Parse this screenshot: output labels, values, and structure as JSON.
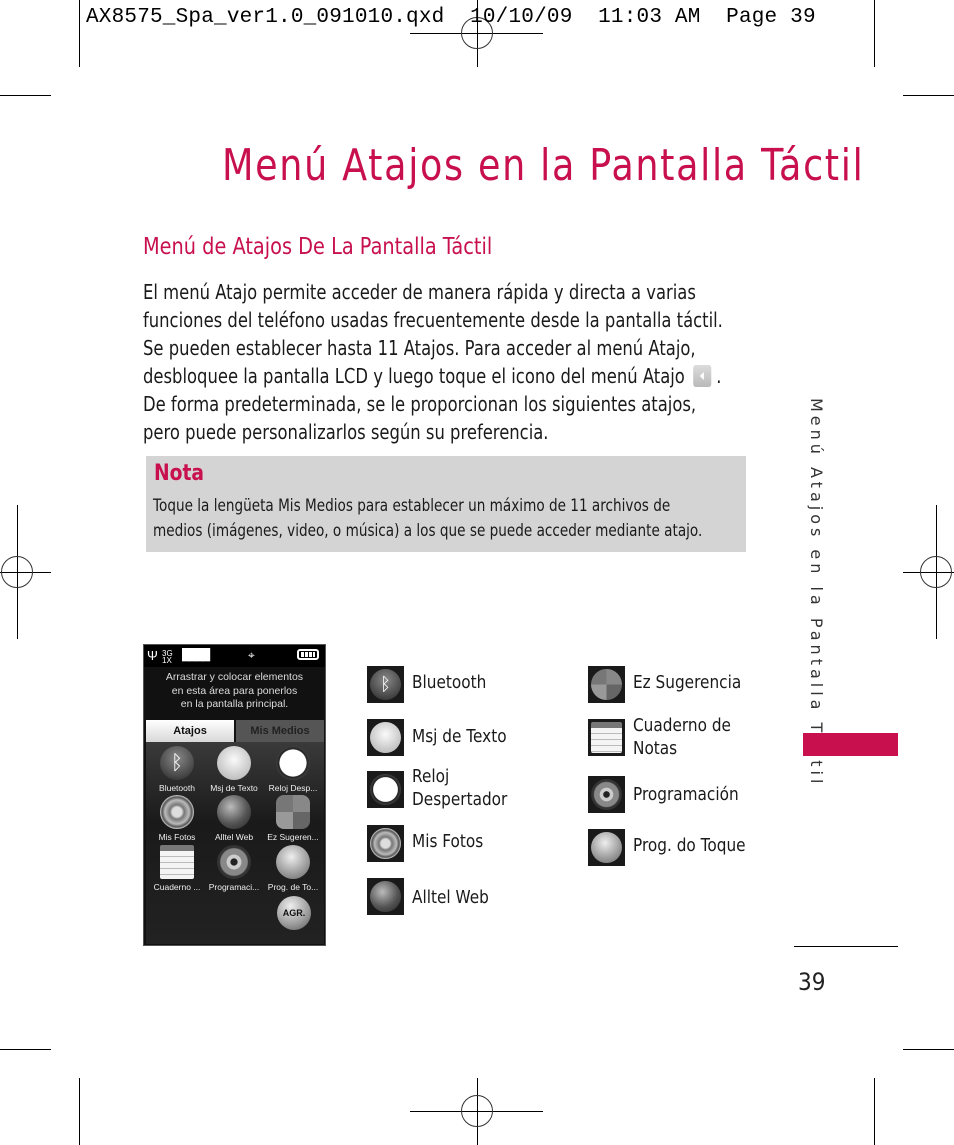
{
  "slug": {
    "file": "AX8575_Spa_ver1.0_091010.qxd",
    "date": "10/10/09",
    "time": "11:03 AM",
    "page": "Page 39"
  },
  "title": "Menú Atajos en la Pantalla Táctil",
  "subtitle": "Menú de Atajos De La Pantalla Táctil",
  "body_lines": [
    "El menú Atajo permite acceder de manera rápida y directa a varias",
    "funciones del teléfono usadas frecuentemente desde la pantalla táctil.",
    "Se pueden establecer hasta 11  Atajos.  Para acceder al menú Atajo,",
    "desbloquee la pantalla LCD y luego toque el icono del menú Atajo",
    "De forma predeterminada, se le proporcionan los siguientes atajos,",
    "pero puede personalizarlos según su preferencia."
  ],
  "body_line4_suffix": ".",
  "note": {
    "title": "Nota",
    "lines": [
      "Toque la lengüeta Mis Medios para establecer un máximo de 11  archivos de",
      "medios (imágenes, video, o música) a los que se puede acceder mediante atajo."
    ]
  },
  "side_label": "Menú Atajos en la Pantalla Táctil",
  "page_number": "39",
  "phone": {
    "status": {
      "network": "3G 1X",
      "signal_icon": "signal-antenna-icon",
      "center_icon": "location-icon",
      "battery_icon": "battery-full-icon"
    },
    "message_lines": [
      "Arrastrar y colocar elementos",
      "en esta área para ponerlos",
      "en la pantalla principal."
    ],
    "tabs": [
      "Atajos",
      "Mis Medios"
    ],
    "active_tab": "Atajos",
    "items": [
      {
        "label": "Bluetooth",
        "icon": "bluetooth-icon"
      },
      {
        "label": "Msj de Texto",
        "icon": "message-icon"
      },
      {
        "label": "Reloj Desp...",
        "icon": "alarm-clock-icon"
      },
      {
        "label": "Mis Fotos",
        "icon": "photos-icon"
      },
      {
        "label": "Alltel Web",
        "icon": "globe-icon"
      },
      {
        "label": "Ez Sugeren...",
        "icon": "calculator-icon"
      },
      {
        "label": "Cuaderno ...",
        "icon": "notepad-icon"
      },
      {
        "label": "Programaci...",
        "icon": "gear-icon"
      },
      {
        "label": "Prog. de To...",
        "icon": "touch-settings-icon"
      }
    ],
    "add_button": "AGR."
  },
  "legend": {
    "left": [
      {
        "label": [
          "Bluetooth"
        ],
        "icon": "bluetooth-icon"
      },
      {
        "label": [
          "Msj de Texto"
        ],
        "icon": "message-icon"
      },
      {
        "label": [
          "Reloj",
          "Despertador"
        ],
        "icon": "alarm-clock-icon"
      },
      {
        "label": [
          "Mis Fotos"
        ],
        "icon": "photos-icon"
      },
      {
        "label": [
          "Alltel Web"
        ],
        "icon": "globe-icon"
      }
    ],
    "right": [
      {
        "label": [
          "Ez Sugerencia"
        ],
        "icon": "calculator-icon"
      },
      {
        "label": [
          "Cuaderno de",
          "Notas"
        ],
        "icon": "notepad-icon"
      },
      {
        "label": [
          "Programación"
        ],
        "icon": "gear-icon"
      },
      {
        "label": [
          "Prog. do Toque"
        ],
        "icon": "touch-settings-icon"
      }
    ]
  },
  "colors": {
    "accent": "#c8104e",
    "note_bg": "#d4d4d4"
  }
}
